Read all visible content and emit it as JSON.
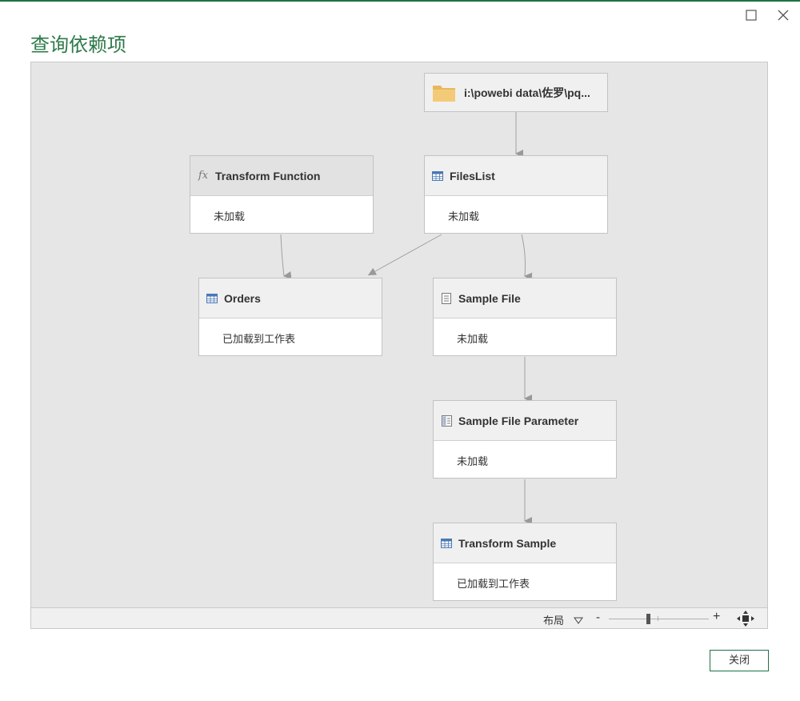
{
  "dialog": {
    "title": "查询依赖项",
    "close_button": "关闭",
    "window_icons": {
      "maximize": "maximize-icon",
      "close": "close-icon"
    }
  },
  "graph": {
    "source": {
      "label": "i:\\powebi data\\佐罗\\pq...",
      "icon": "folder-icon"
    },
    "nodes": [
      {
        "id": "transform_function",
        "label": "Transform Function",
        "status": "未加载",
        "icon": "function-icon"
      },
      {
        "id": "fileslist",
        "label": "FilesList",
        "status": "未加载",
        "icon": "table-icon"
      },
      {
        "id": "orders",
        "label": "Orders",
        "status": "已加载到工作表",
        "icon": "table-icon"
      },
      {
        "id": "sample_file",
        "label": "Sample File",
        "status": "未加载",
        "icon": "document-icon"
      },
      {
        "id": "sample_file_parameter",
        "label": "Sample File Parameter",
        "status": "未加载",
        "icon": "parameter-icon"
      },
      {
        "id": "transform_sample",
        "label": "Transform Sample",
        "status": "已加载到工作表",
        "icon": "table-icon"
      }
    ]
  },
  "statusbar": {
    "layout_label": "布局",
    "zoom_minus": "-",
    "zoom_plus": "+",
    "fit_icon": "fit-to-screen-icon"
  },
  "colors": {
    "accent": "#1e7145",
    "title": "#2e7a4a",
    "canvas": "#e6e6e6"
  }
}
